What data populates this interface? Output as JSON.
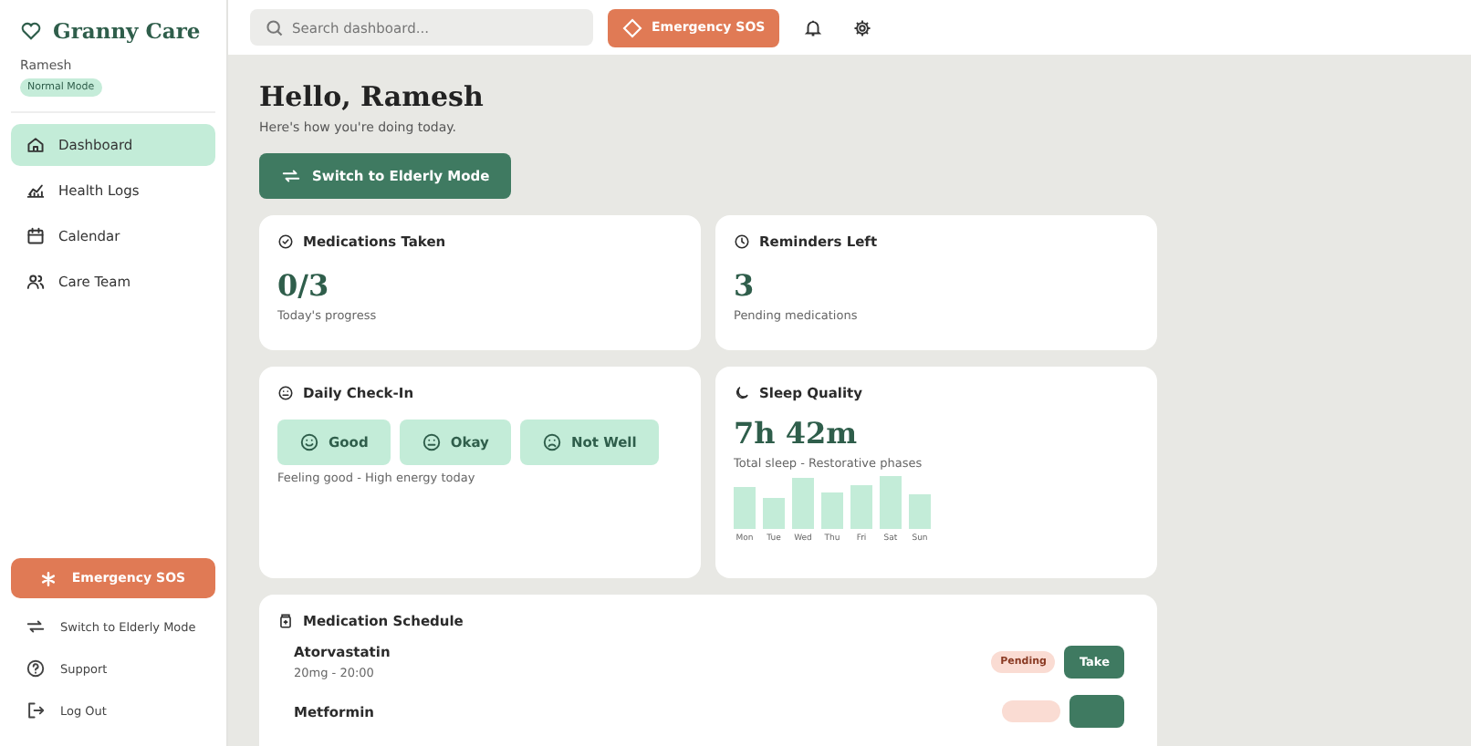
{
  "sidebar": {
    "brand": "Granny Care",
    "user": "Ramesh",
    "mode_badge": "Normal Mode",
    "nav": [
      {
        "label": "Dashboard",
        "selected": true
      },
      {
        "label": "Health Logs",
        "selected": false
      },
      {
        "label": "Calendar",
        "selected": false
      },
      {
        "label": "Care Team",
        "selected": false
      }
    ],
    "sos_button": "Emergency SOS",
    "footer_links": [
      {
        "label": "Switch to Elderly Mode"
      },
      {
        "label": "Support"
      },
      {
        "label": "Log Out"
      }
    ]
  },
  "topbar": {
    "search": {
      "placeholder": "Search dashboard..."
    },
    "sos_button": "Emergency SOS"
  },
  "greeting": {
    "title": "Hello, Ramesh",
    "subtitle": "Here's how you're doing today."
  },
  "mode_button": "Switch to Elderly Mode",
  "stats": [
    {
      "title": "Medications Taken",
      "value": "0/3",
      "caption": "Today's progress"
    },
    {
      "title": "Reminders Left",
      "value": "3",
      "caption": "Pending medications"
    }
  ],
  "checkin": {
    "title": "Daily Check-In",
    "options": [
      {
        "label": "Good"
      },
      {
        "label": "Okay"
      },
      {
        "label": "Not Well"
      }
    ],
    "note": "Feeling good - High energy today"
  },
  "sleep": {
    "title": "Sleep Quality",
    "value": "7h 42m",
    "caption": "Total sleep - Restorative phases",
    "days": [
      "Mon",
      "Tue",
      "Wed",
      "Thu",
      "Fri",
      "Sat",
      "Sun"
    ]
  },
  "schedule": {
    "title": "Medication Schedule",
    "items": [
      {
        "name": "Atorvastatin",
        "dose": "20mg - 20:00",
        "status": "Pending",
        "action": "Take"
      },
      {
        "name": "Metformin"
      }
    ]
  }
}
